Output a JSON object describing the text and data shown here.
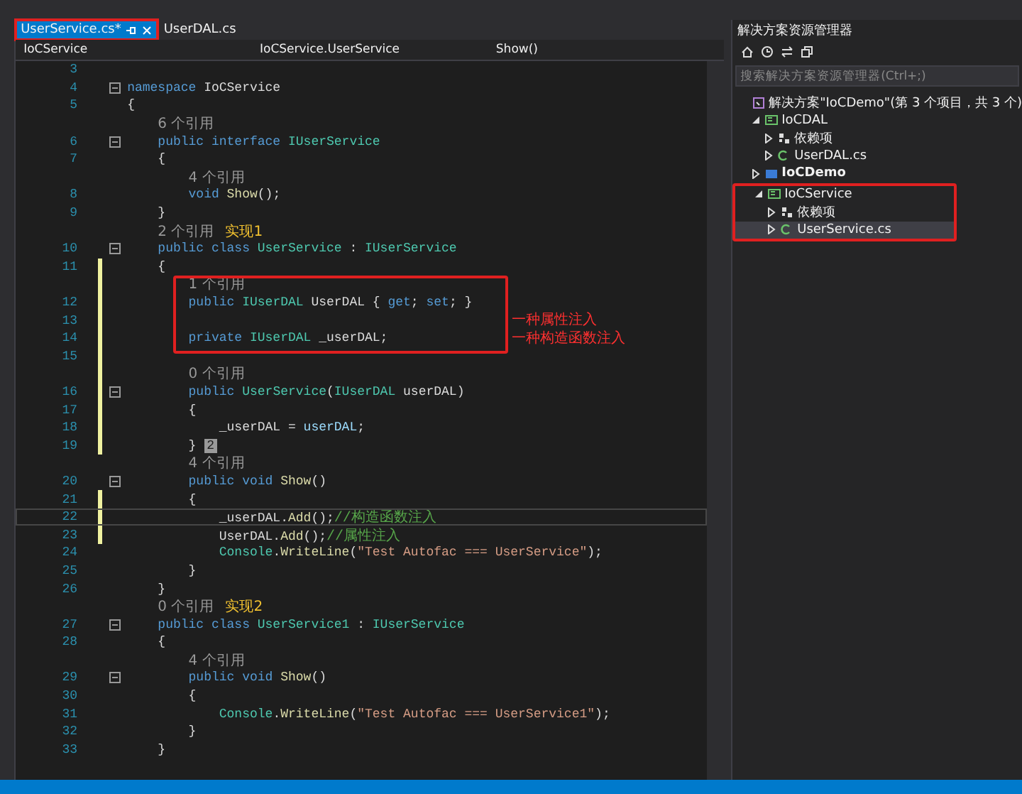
{
  "tabs": [
    {
      "label": "UserService.cs*",
      "selected": true,
      "highlighted": true
    },
    {
      "label": "UserDAL.cs",
      "selected": false,
      "highlighted": false
    }
  ],
  "nav": {
    "project": "IoCService",
    "type": "IoCService.UserService",
    "member": "Show()"
  },
  "editor": {
    "rows": [
      {
        "kind": "code",
        "number": "3",
        "fold": false,
        "changed": false,
        "current": false,
        "boxed": false,
        "tokens": []
      },
      {
        "kind": "code",
        "number": "4",
        "fold": true,
        "changed": false,
        "current": false,
        "boxed": false,
        "tokens": [
          {
            "text": "namespace",
            "kind": "keyword"
          },
          {
            "text": " IoCService",
            "kind": "plain"
          }
        ]
      },
      {
        "kind": "code",
        "number": "5",
        "fold": false,
        "changed": false,
        "current": false,
        "boxed": false,
        "tokens": [
          {
            "text": "{",
            "kind": "plain"
          }
        ]
      },
      {
        "kind": "lens",
        "text": "    6 个引用",
        "changed": false,
        "boxed": false
      },
      {
        "kind": "code",
        "number": "6",
        "fold": true,
        "changed": false,
        "current": false,
        "boxed": false,
        "tokens": [
          {
            "text": "    public",
            "kind": "keyword"
          },
          {
            "text": " interface",
            "kind": "keyword"
          },
          {
            "text": " IUserService",
            "kind": "type"
          }
        ]
      },
      {
        "kind": "code",
        "number": "7",
        "fold": false,
        "changed": false,
        "current": false,
        "boxed": false,
        "tokens": [
          {
            "text": "    {",
            "kind": "plain"
          }
        ]
      },
      {
        "kind": "lens",
        "text": "        4 个引用",
        "changed": false,
        "boxed": false
      },
      {
        "kind": "code",
        "number": "8",
        "fold": false,
        "changed": false,
        "current": false,
        "boxed": false,
        "tokens": [
          {
            "text": "        void",
            "kind": "keyword"
          },
          {
            "text": " Show",
            "kind": "method"
          },
          {
            "text": "();",
            "kind": "plain"
          }
        ]
      },
      {
        "kind": "code",
        "number": "9",
        "fold": false,
        "changed": false,
        "current": false,
        "boxed": false,
        "tokens": [
          {
            "text": "    }",
            "kind": "plain"
          }
        ]
      },
      {
        "kind": "lens",
        "text": "    2 个引用",
        "note": "实现1",
        "changed": false,
        "boxed": false
      },
      {
        "kind": "code",
        "number": "10",
        "fold": true,
        "changed": false,
        "current": false,
        "boxed": false,
        "tokens": [
          {
            "text": "    public",
            "kind": "keyword"
          },
          {
            "text": " class",
            "kind": "keyword"
          },
          {
            "text": " UserService",
            "kind": "type"
          },
          {
            "text": " : ",
            "kind": "plain"
          },
          {
            "text": "IUserService",
            "kind": "type"
          }
        ]
      },
      {
        "kind": "code",
        "number": "11",
        "fold": false,
        "changed": true,
        "current": false,
        "boxed": false,
        "tokens": [
          {
            "text": "    {",
            "kind": "plain"
          }
        ]
      },
      {
        "kind": "lens",
        "text": "        1 个引用",
        "changed": true,
        "boxed": true
      },
      {
        "kind": "code",
        "number": "12",
        "fold": false,
        "changed": true,
        "current": false,
        "boxed": true,
        "tokens": [
          {
            "text": "        public",
            "kind": "keyword"
          },
          {
            "text": " IUserDAL",
            "kind": "type"
          },
          {
            "text": " UserDAL { ",
            "kind": "plain"
          },
          {
            "text": "get",
            "kind": "keyword"
          },
          {
            "text": "; ",
            "kind": "plain"
          },
          {
            "text": "set",
            "kind": "keyword"
          },
          {
            "text": "; }",
            "kind": "plain"
          }
        ]
      },
      {
        "kind": "code",
        "number": "13",
        "fold": false,
        "changed": true,
        "current": false,
        "boxed": true,
        "tokens": []
      },
      {
        "kind": "code",
        "number": "14",
        "fold": false,
        "changed": true,
        "current": false,
        "boxed": true,
        "tokens": [
          {
            "text": "        private",
            "kind": "keyword"
          },
          {
            "text": " IUserDAL",
            "kind": "type"
          },
          {
            "text": " _userDAL;",
            "kind": "plain"
          }
        ]
      },
      {
        "kind": "code",
        "number": "15",
        "fold": false,
        "changed": true,
        "current": false,
        "boxed": false,
        "tokens": []
      },
      {
        "kind": "lens",
        "text": "        0 个引用",
        "changed": true,
        "boxed": false
      },
      {
        "kind": "code",
        "number": "16",
        "fold": true,
        "changed": true,
        "current": false,
        "boxed": false,
        "tokens": [
          {
            "text": "        public",
            "kind": "keyword"
          },
          {
            "text": " UserService",
            "kind": "type"
          },
          {
            "text": "(",
            "kind": "plain"
          },
          {
            "text": "IUserDAL",
            "kind": "type"
          },
          {
            "text": " userDAL)",
            "kind": "plain"
          }
        ]
      },
      {
        "kind": "code",
        "number": "17",
        "fold": false,
        "changed": true,
        "current": false,
        "boxed": false,
        "tokens": [
          {
            "text": "        {",
            "kind": "plain"
          }
        ]
      },
      {
        "kind": "code",
        "number": "18",
        "fold": false,
        "changed": true,
        "current": false,
        "boxed": false,
        "tokens": [
          {
            "text": "            _userDAL = ",
            "kind": "plain"
          },
          {
            "text": "userDAL",
            "kind": "param"
          },
          {
            "text": ";",
            "kind": "plain"
          }
        ]
      },
      {
        "kind": "code",
        "number": "19",
        "fold": false,
        "changed": true,
        "current": false,
        "boxed": false,
        "tokens": [
          {
            "text": "        } ",
            "kind": "plain"
          },
          {
            "text": "2",
            "kind": "badge"
          }
        ]
      },
      {
        "kind": "lens",
        "text": "        4 个引用",
        "changed": false,
        "boxed": false
      },
      {
        "kind": "code",
        "number": "20",
        "fold": true,
        "changed": false,
        "current": false,
        "boxed": false,
        "tokens": [
          {
            "text": "        public",
            "kind": "keyword"
          },
          {
            "text": " void",
            "kind": "keyword"
          },
          {
            "text": " Show",
            "kind": "method"
          },
          {
            "text": "()",
            "kind": "plain"
          }
        ]
      },
      {
        "kind": "code",
        "number": "21",
        "fold": false,
        "changed": true,
        "current": false,
        "boxed": false,
        "tokens": [
          {
            "text": "        {",
            "kind": "plain"
          }
        ]
      },
      {
        "kind": "code",
        "number": "22",
        "fold": false,
        "changed": true,
        "current": true,
        "boxed": false,
        "tokens": [
          {
            "text": "            _userDAL.",
            "kind": "plain"
          },
          {
            "text": "Add",
            "kind": "method"
          },
          {
            "text": "();",
            "kind": "plain"
          },
          {
            "text": "//构造函数注入",
            "kind": "comment"
          }
        ]
      },
      {
        "kind": "code",
        "number": "23",
        "fold": false,
        "changed": true,
        "current": false,
        "boxed": false,
        "tokens": [
          {
            "text": "            UserDAL.",
            "kind": "plain"
          },
          {
            "text": "Add",
            "kind": "method"
          },
          {
            "text": "();",
            "kind": "plain"
          },
          {
            "text": "//属性注入",
            "kind": "comment"
          }
        ]
      },
      {
        "kind": "code",
        "number": "24",
        "fold": false,
        "changed": false,
        "current": false,
        "boxed": false,
        "tokens": [
          {
            "text": "            Console",
            "kind": "type"
          },
          {
            "text": ".",
            "kind": "plain"
          },
          {
            "text": "WriteLine",
            "kind": "method"
          },
          {
            "text": "(",
            "kind": "plain"
          },
          {
            "text": "\"Test Autofac === UserService\"",
            "kind": "string"
          },
          {
            "text": ");",
            "kind": "plain"
          }
        ]
      },
      {
        "kind": "code",
        "number": "25",
        "fold": false,
        "changed": false,
        "current": false,
        "boxed": false,
        "tokens": [
          {
            "text": "        }",
            "kind": "plain"
          }
        ]
      },
      {
        "kind": "code",
        "number": "26",
        "fold": false,
        "changed": false,
        "current": false,
        "boxed": false,
        "tokens": [
          {
            "text": "    }",
            "kind": "plain"
          }
        ]
      },
      {
        "kind": "lens",
        "text": "    0 个引用",
        "note": "实现2",
        "changed": false,
        "boxed": false
      },
      {
        "kind": "code",
        "number": "27",
        "fold": true,
        "changed": false,
        "current": false,
        "boxed": false,
        "tokens": [
          {
            "text": "    public",
            "kind": "keyword"
          },
          {
            "text": " class",
            "kind": "keyword"
          },
          {
            "text": " UserService1",
            "kind": "type"
          },
          {
            "text": " : ",
            "kind": "plain"
          },
          {
            "text": "IUserService",
            "kind": "type"
          }
        ]
      },
      {
        "kind": "code",
        "number": "28",
        "fold": false,
        "changed": false,
        "current": false,
        "boxed": false,
        "tokens": [
          {
            "text": "    {",
            "kind": "plain"
          }
        ]
      },
      {
        "kind": "lens",
        "text": "        4 个引用",
        "changed": false,
        "boxed": false
      },
      {
        "kind": "code",
        "number": "29",
        "fold": true,
        "changed": false,
        "current": false,
        "boxed": false,
        "tokens": [
          {
            "text": "        public",
            "kind": "keyword"
          },
          {
            "text": " void",
            "kind": "keyword"
          },
          {
            "text": " Show",
            "kind": "method"
          },
          {
            "text": "()",
            "kind": "plain"
          }
        ]
      },
      {
        "kind": "code",
        "number": "30",
        "fold": false,
        "changed": false,
        "current": false,
        "boxed": false,
        "tokens": [
          {
            "text": "        {",
            "kind": "plain"
          }
        ]
      },
      {
        "kind": "code",
        "number": "31",
        "fold": false,
        "changed": false,
        "current": false,
        "boxed": false,
        "tokens": [
          {
            "text": "            Console",
            "kind": "type"
          },
          {
            "text": ".",
            "kind": "plain"
          },
          {
            "text": "WriteLine",
            "kind": "method"
          },
          {
            "text": "(",
            "kind": "plain"
          },
          {
            "text": "\"Test Autofac === UserService1\"",
            "kind": "string"
          },
          {
            "text": ");",
            "kind": "plain"
          }
        ]
      },
      {
        "kind": "code",
        "number": "32",
        "fold": false,
        "changed": false,
        "current": false,
        "boxed": false,
        "tokens": [
          {
            "text": "        }",
            "kind": "plain"
          }
        ]
      },
      {
        "kind": "code",
        "number": "33",
        "fold": false,
        "changed": false,
        "current": false,
        "boxed": false,
        "tokens": [
          {
            "text": "    }",
            "kind": "plain"
          }
        ]
      }
    ],
    "annotations": [
      "一种属性注入",
      "一种构造函数注入"
    ]
  },
  "solution_explorer": {
    "title": "解决方案资源管理器",
    "search": {
      "placeholder": "搜索解决方案资源管理器(Ctrl+;)"
    },
    "tree": [
      {
        "label": "解决方案\"IoCDemo\"(第 3 个项目，共 3 个)",
        "kind": "solution",
        "bold": false,
        "selected": false,
        "highlighted": false,
        "children": [
          {
            "label": "IoCDAL",
            "kind": "project",
            "expanded": true,
            "bold": false,
            "selected": false,
            "highlighted": false,
            "children": [
              {
                "label": "依赖项",
                "kind": "deps",
                "expanded": false,
                "bold": false,
                "selected": false,
                "highlighted": false
              },
              {
                "label": "UserDAL.cs",
                "kind": "file",
                "expanded": false,
                "bold": false,
                "selected": false,
                "highlighted": false
              }
            ]
          },
          {
            "label": "IoCDemo",
            "kind": "startup",
            "expanded": false,
            "bold": true,
            "selected": false,
            "highlighted": false
          },
          {
            "label": "IoCService",
            "kind": "project",
            "expanded": true,
            "bold": false,
            "selected": false,
            "highlighted": true,
            "children": [
              {
                "label": "依赖项",
                "kind": "deps",
                "expanded": false,
                "bold": false,
                "selected": false,
                "highlighted": false
              },
              {
                "label": "UserService.cs",
                "kind": "file",
                "expanded": false,
                "bold": false,
                "selected": true,
                "highlighted": false
              }
            ]
          }
        ]
      }
    ]
  }
}
